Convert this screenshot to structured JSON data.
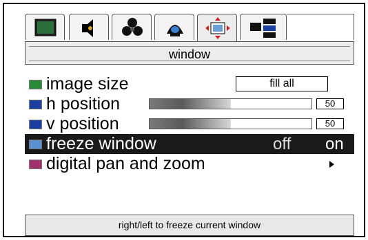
{
  "tabs": [
    {
      "icon": "monitor-icon"
    },
    {
      "icon": "speaker-icon"
    },
    {
      "icon": "color-dots-icon"
    },
    {
      "icon": "lamp-icon"
    },
    {
      "icon": "window-move-icon",
      "active": true
    },
    {
      "icon": "setup-panels-icon"
    }
  ],
  "section_title": "window",
  "menu": {
    "image_size": {
      "label": "image size",
      "value": "fill all",
      "icon": "image-size-icon"
    },
    "h_position": {
      "label": "h position",
      "value": "50",
      "level": 0.5,
      "icon": "h-position-icon"
    },
    "v_position": {
      "label": "v position",
      "value": "50",
      "level": 0.5,
      "icon": "v-position-icon"
    },
    "freeze_window": {
      "label": "freeze window",
      "option_off": "off",
      "option_on": "on",
      "selected": "on",
      "icon": "freeze-window-icon"
    },
    "digital_pan_zoom": {
      "label": "digital pan and zoom",
      "icon": "pan-zoom-icon"
    }
  },
  "hint": "right/left to freeze current window",
  "colors": {
    "accent_blue": "#1a3fa0",
    "selected_row": "#1a1a1a",
    "active_tab_red": "#d22020"
  }
}
